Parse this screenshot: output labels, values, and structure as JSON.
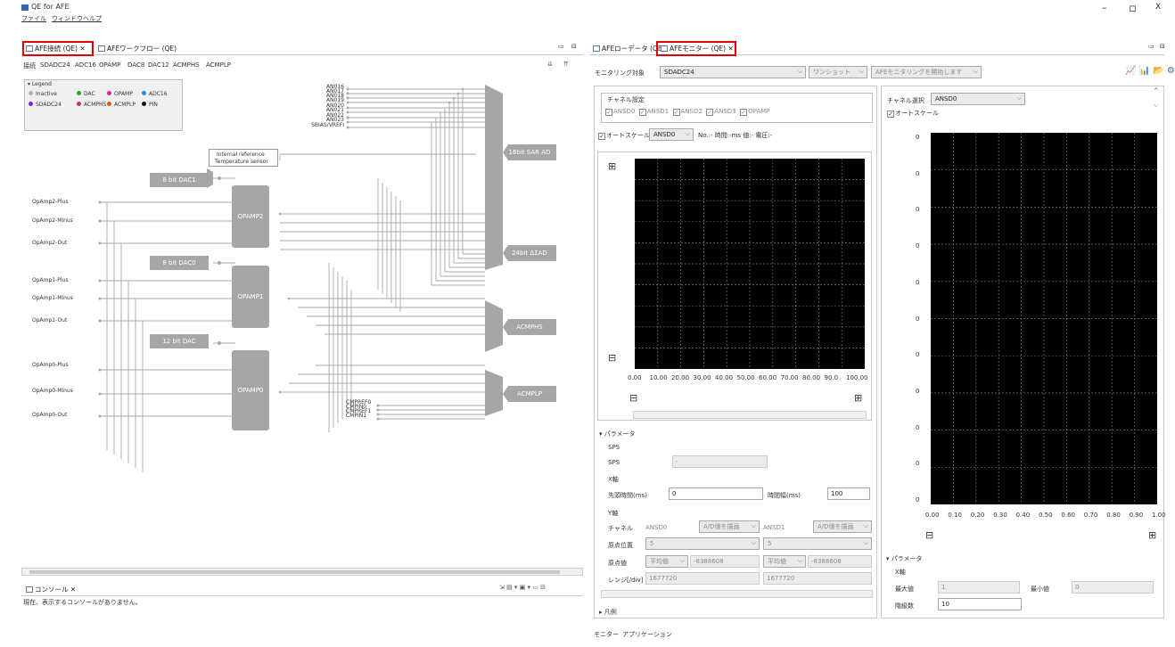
{
  "window": {
    "title": "QE for AFE",
    "minimize": "–",
    "restore": "ロ",
    "close": "X"
  },
  "menu": [
    "ファイル",
    "ウィンドウ",
    "ヘルプ"
  ],
  "left_tabs": {
    "tab1": "AFE接続 (QE)",
    "tab1_close": "✕",
    "tab2": "AFEワークフロー (QE)"
  },
  "subtabs": [
    "接続",
    "SDADC24",
    "ADC16",
    "OPAMP",
    "DAC8",
    "DAC12",
    "ACMPHS",
    "ACMPLP"
  ],
  "legend": {
    "title": "▾ Legend",
    "items": [
      {
        "name": "Inactive",
        "color": "#b0b0b0"
      },
      {
        "name": "DAC",
        "color": "#22aa22"
      },
      {
        "name": "OPAMP",
        "color": "#dd22aa"
      },
      {
        "name": "ADC16",
        "color": "#2a8ae8"
      },
      {
        "name": "SDADC24",
        "color": "#7a22cc"
      },
      {
        "name": "ACMPHS",
        "color": "#cc3366"
      },
      {
        "name": "ACMPLP",
        "color": "#ee5511"
      },
      {
        "name": "PIN",
        "color": "#111111"
      }
    ]
  },
  "diagram": {
    "an_pins": [
      "AN016",
      "AN017",
      "AN018",
      "AN019",
      "AN020",
      "AN021",
      "AN022",
      "AN023",
      "SBIAS/VREFI"
    ],
    "internal_ref": [
      "Internal reference",
      "Temperature sensor"
    ],
    "blocks": {
      "dac1": "8 bit DAC1",
      "dac0": "8 bit DAC0",
      "dac12": "12 bit DAC",
      "opamp2": "OPAMP2",
      "opamp1": "OPAMP1",
      "opamp0": "OPAMP0",
      "sar": "16bit SAR AD",
      "sigma": "24bit ΔΣAD",
      "acmphs": "ACMPHS",
      "acmplp": "ACMPLP"
    },
    "op_pins": [
      "OpAmp2-Plus",
      "OpAmp2-Minus",
      "OpAmp2-Out",
      "OpAmp1-Plus",
      "OpAmp1-Minus",
      "OpAmp1-Out",
      "OpAmp0-Plus",
      "OpAmp0-Minus",
      "OpAmp0-Out"
    ],
    "cmp_pins": [
      "CMPREF0",
      "CMPIN0",
      "CMPREF1",
      "CMPIN1"
    ]
  },
  "console": {
    "tab": "コンソール",
    "close": "✕",
    "message": "現在、表示するコンソールがありません。"
  },
  "right_tabs": {
    "tab1": "AFEローデータ (QE)",
    "tab2": "AFEモニター (QE)",
    "tab2_close": "✕"
  },
  "toolbar": {
    "target_label": "モニタリング対象",
    "target_value": "SDADC24",
    "mode_value": "ワンショット",
    "start_button": "AFEモニタリングを開始します"
  },
  "channel_settings": {
    "title": "チャネル設定",
    "channels": [
      "ANSD0",
      "ANSD1",
      "ANSD2",
      "ANSD3",
      "OPAMP"
    ]
  },
  "autoscale_row": {
    "label": "オートスケール",
    "channel": "ANSD0",
    "info": "No.:- 時間:-ms 値:- 電圧:-"
  },
  "plot1_xticks": [
    "0.00",
    "10.00",
    "20.00",
    "30.00",
    "40.00",
    "50.00",
    "60.00",
    "70.00",
    "80.00",
    "90.0",
    "100.00"
  ],
  "zoom": {
    "plus": "⊞",
    "minus": "⊟"
  },
  "params": {
    "title": "▾ パラメータ",
    "sps_section": "SPS",
    "sps_label": "SPS",
    "sps_value": "-",
    "x_section": "X軸",
    "start_label": "先頭時間(ms)",
    "start_value": "0",
    "width_label": "時間幅(ms)",
    "width_value": "100",
    "y_section": "Y軸",
    "ch_label": "チャネル",
    "ch1": "ANSD0",
    "ch1_mode": "A/D値を描画",
    "ch2": "ANSD1",
    "ch2_mode": "A/D値を描画",
    "origin_label": "原点位置",
    "origin1": "5",
    "origin2": "5",
    "origin_val_label": "原点値",
    "avg": "平均値",
    "origin_val": "-8388608",
    "range_label": "レンジ[/div]",
    "range_val": "1677720"
  },
  "legend2": "▸ 凡例",
  "bottom_tabs": [
    "モニター",
    "アプリケーション"
  ],
  "histogram": {
    "ch_label": "チャネル選択",
    "ch_value": "ANSD0",
    "autoscale": "オートスケール",
    "yticks": [
      "0",
      "0",
      "0",
      "0",
      "0",
      "0",
      "0",
      "0",
      "0",
      "0",
      "0"
    ],
    "xticks": [
      "0.00",
      "0.10",
      "0.20",
      "0.30",
      "0.40",
      "0.50",
      "0.60",
      "0.70",
      "0.80",
      "0.90",
      "1.00"
    ],
    "params_title": "▾ パラメータ",
    "x_section": "X軸",
    "max_label": "最大値",
    "max_value": "1",
    "min_label": "最小値",
    "min_value": "0",
    "bins_label": "階級数",
    "bins_value": "10"
  }
}
